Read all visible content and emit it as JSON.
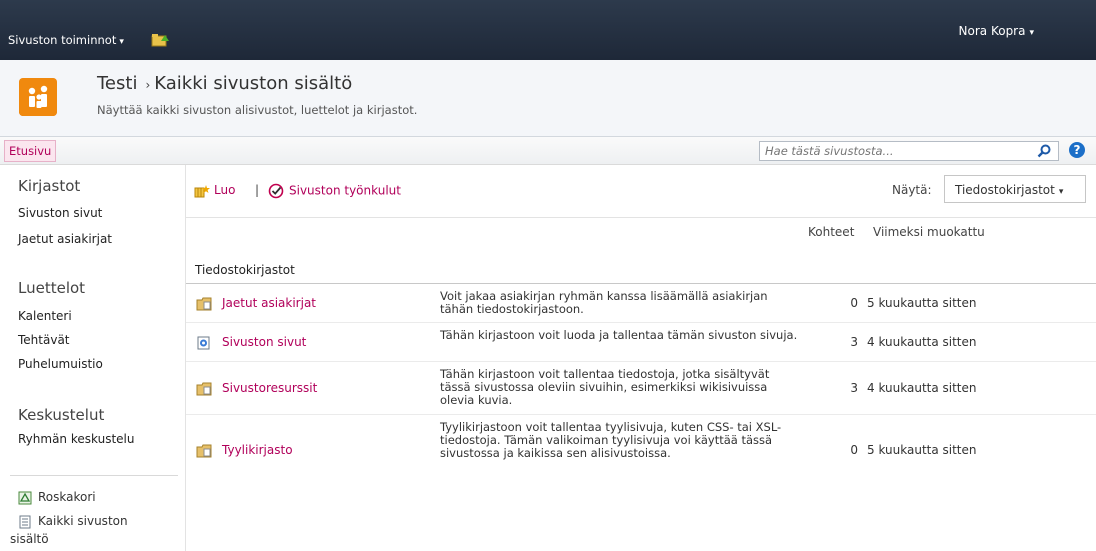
{
  "topbar": {
    "site_actions": "Sivuston toiminnot",
    "user": "Nora Kopra",
    "caret": "▾"
  },
  "title": {
    "site": "Testi",
    "separator": "›",
    "page": "Kaikki sivuston sisältö",
    "description": "Näyttää kaikki sivuston alisivustot, luettelot ja kirjastot."
  },
  "topnav": {
    "home_tab": "Etusivu",
    "search_placeholder": "Hae tästä sivustosta...",
    "help": "?"
  },
  "leftnav": {
    "libraries_head": "Kirjastot",
    "libraries": [
      "Sivuston sivut",
      "Jaetut asiakirjat"
    ],
    "lists_head": "Luettelot",
    "lists": [
      "Kalenteri",
      "Tehtävät",
      "Puhelumuistio"
    ],
    "discussions_head": "Keskustelut",
    "discussions": [
      "Ryhmän keskustelu"
    ],
    "recycle_bin": "Roskakori",
    "all_content_line1": "Kaikki sivuston",
    "all_content_line2": "sisältö"
  },
  "toolbar": {
    "create": "Luo",
    "separator": "|",
    "workflows": "Sivuston työnkulut",
    "view_label": "Näytä:",
    "view_value": "Tiedostokirjastot"
  },
  "columns": {
    "items": "Kohteet",
    "modified": "Viimeksi muokattu"
  },
  "group": "Tiedostokirjastot",
  "rows": [
    {
      "name": "Jaetut asiakirjat",
      "desc": "Voit jakaa asiakirjan ryhmän kanssa lisäämällä asiakirjan tähän tiedostokirjastoon.",
      "count": "0",
      "modified": "5 kuukautta sitten",
      "icon": "folder-icon"
    },
    {
      "name": "Sivuston sivut",
      "desc": "Tähän kirjastoon voit luoda ja tallentaa tämän sivuston sivuja.",
      "count": "3",
      "modified": "4 kuukautta sitten",
      "icon": "wiki-page-icon"
    },
    {
      "name": "Sivustoresurssit",
      "desc": "Tähän kirjastoon voit tallentaa tiedostoja, jotka sisältyvät tässä sivustossa oleviin sivuihin, esimerkiksi wikisivuissa olevia kuvia.",
      "count": "3",
      "modified": "4 kuukautta sitten",
      "icon": "folder-icon"
    },
    {
      "name": "Tyylikirjasto",
      "desc": "Tyylikirjastoon voit tallentaa tyylisivuja, kuten CSS- tai XSL-tiedostoja. Tämän valikoiman tyylisivuja voi käyttää tässä sivustossa ja kaikissa sen alisivustoissa.",
      "count": "0",
      "modified": "5 kuukautta sitten",
      "icon": "folder-icon"
    }
  ],
  "colors": {
    "accent": "#b1005a",
    "topbar": "#1e2838",
    "logo": "#f0890e"
  }
}
